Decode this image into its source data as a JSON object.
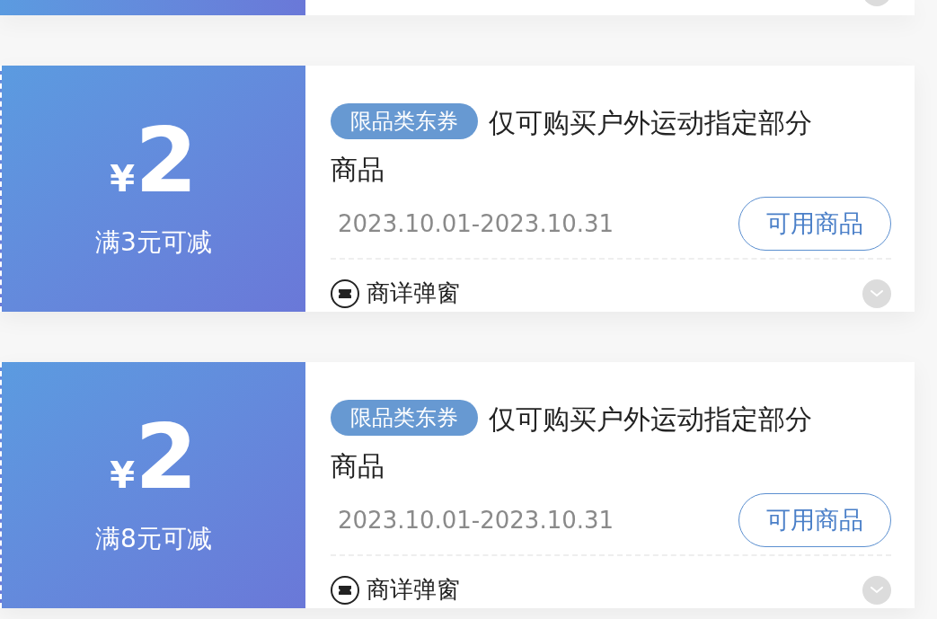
{
  "coupons": [
    {
      "currency": "¥",
      "amount": "2",
      "condition": "满3元可减",
      "badge": "限品类东券",
      "title": "仅可购买户外运动指定部分商品",
      "validity": "2023.10.01-2023.10.31",
      "button": "可用商品",
      "detail": "商详弹窗",
      "expanded": false
    },
    {
      "currency": "¥",
      "amount": "2",
      "condition": "满8元可减",
      "badge": "限品类东券",
      "title": "仅可购买户外运动指定部分商品",
      "validity": "2023.10.01-2023.10.31",
      "button": "可用商品",
      "detail": "商详弹窗",
      "expanded": false
    }
  ]
}
